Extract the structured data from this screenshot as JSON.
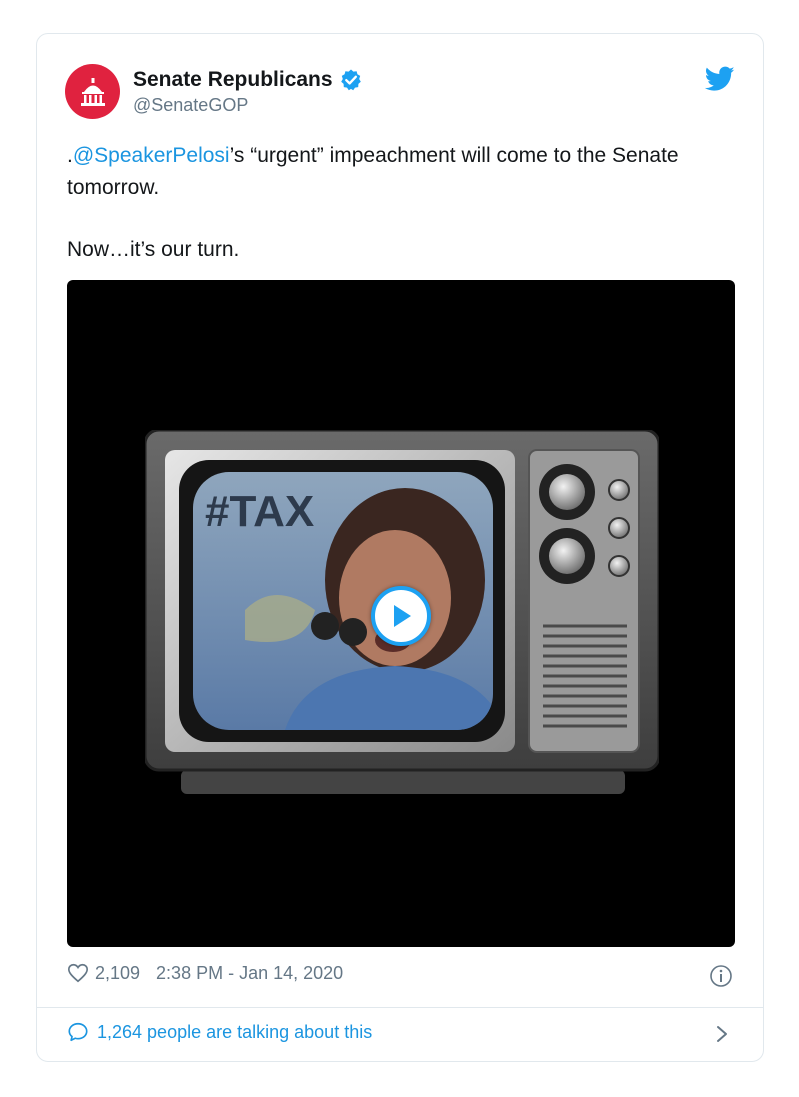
{
  "tweet": {
    "display_name": "Senate Republicans",
    "handle": "@SenateGOP",
    "text_prefix": ".",
    "mention": "@SpeakerPelosi",
    "text_rest": "’s “urgent” impeachment will come to the Senate tomorrow.",
    "text_line2": "Now…it’s our turn.",
    "likes": "2,109",
    "timestamp": "2:38 PM - Jan 14, 2020",
    "talking": "1,264 people are talking about this"
  },
  "icons": {
    "avatar": "capitol-dome-icon",
    "verified": "verified-badge-icon",
    "brand": "twitter-bird-icon",
    "like": "heart-icon",
    "info": "info-icon",
    "comment": "comment-icon",
    "chevron": "chevron-right-icon",
    "play": "play-icon"
  },
  "colors": {
    "accent": "#1b95e0",
    "avatar_bg": "#e0223f",
    "muted": "#657786",
    "media_bg": "#000000"
  }
}
